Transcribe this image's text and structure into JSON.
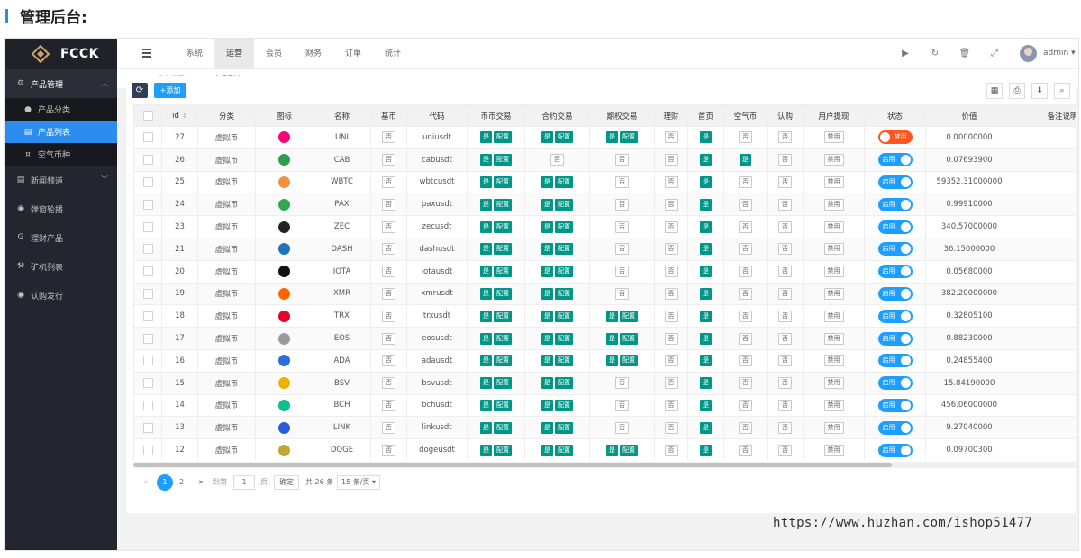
{
  "page_heading": "管理后台:",
  "app": {
    "logo_text": "FCCK",
    "sidebar": {
      "groups": [
        {
          "label": "产品管理",
          "icon": "gear-icon",
          "expanded": true,
          "children": [
            {
              "label": "产品分类",
              "icon": "dot-icon"
            },
            {
              "label": "产品列表",
              "icon": "list-icon",
              "active": true
            },
            {
              "label": "空气币种",
              "icon": "coin-icon"
            }
          ]
        },
        {
          "label": "新闻频道",
          "icon": "news-icon"
        },
        {
          "label": "弹窗轮播",
          "icon": "slides-icon"
        },
        {
          "label": "理财产品",
          "icon": "finance-icon"
        },
        {
          "label": "矿机列表",
          "icon": "miner-icon"
        },
        {
          "label": "认购发行",
          "icon": "subscribe-icon"
        }
      ]
    },
    "header": {
      "menu": [
        "系统",
        "运营",
        "会员",
        "财务",
        "订单",
        "统计"
      ],
      "active_menu": "运营",
      "user": "admin"
    },
    "tabs": [
      {
        "label": "后台首页",
        "active": false
      },
      {
        "label": "产品列表",
        "active": true,
        "close": "×"
      }
    ]
  },
  "toolbar": {
    "add_label": "+添加",
    "refresh_icon": "⟳"
  },
  "table": {
    "headers": [
      "",
      "id",
      "分类",
      "图标",
      "名称",
      "基币",
      "代码",
      "币币交易",
      "合约交易",
      "期权交易",
      "理财",
      "首页",
      "空气币",
      "认购",
      "用户提现",
      "状态",
      "价值",
      "备注说明"
    ],
    "labels": {
      "yes": "是",
      "no": "否",
      "config": "配置",
      "disable": "禁用",
      "enable": "启用",
      "off": "禁用"
    },
    "rows": [
      {
        "id": "27",
        "category": "虚拟币",
        "name": "UNI",
        "code": "uniusdt",
        "coin_color": "#ff007a",
        "spot": true,
        "contract": true,
        "options": true,
        "home": true,
        "airdrop": false,
        "status": "off",
        "value": "0.00000000"
      },
      {
        "id": "26",
        "category": "虚拟币",
        "name": "CAB",
        "code": "cabusdt",
        "coin_color": "#2e9e4f",
        "spot": true,
        "contract": false,
        "options": false,
        "home": true,
        "airdrop": true,
        "status": "on",
        "value": "0.07693900"
      },
      {
        "id": "25",
        "category": "虚拟币",
        "name": "WBTC",
        "code": "wbtcusdt",
        "coin_color": "#f09242",
        "spot": true,
        "contract": true,
        "options": false,
        "home": true,
        "airdrop": false,
        "status": "on",
        "value": "59352.31000000"
      },
      {
        "id": "24",
        "category": "虚拟币",
        "name": "PAX",
        "code": "paxusdt",
        "coin_color": "#2fa84f",
        "spot": true,
        "contract": true,
        "options": false,
        "home": true,
        "airdrop": false,
        "status": "on",
        "value": "0.99910000"
      },
      {
        "id": "23",
        "category": "虚拟币",
        "name": "ZEC",
        "code": "zecusdt",
        "coin_color": "#222222",
        "spot": true,
        "contract": true,
        "options": false,
        "home": true,
        "airdrop": false,
        "status": "on",
        "value": "340.57000000"
      },
      {
        "id": "21",
        "category": "虚拟币",
        "name": "DASH",
        "code": "dashusdt",
        "coin_color": "#1c75bc",
        "spot": true,
        "contract": true,
        "options": false,
        "home": true,
        "airdrop": false,
        "status": "on",
        "value": "36.15000000"
      },
      {
        "id": "20",
        "category": "虚拟币",
        "name": "IOTA",
        "code": "iotausdt",
        "coin_color": "#111111",
        "spot": true,
        "contract": true,
        "options": false,
        "home": true,
        "airdrop": false,
        "status": "on",
        "value": "0.05680000"
      },
      {
        "id": "19",
        "category": "虚拟币",
        "name": "XMR",
        "code": "xmrusdt",
        "coin_color": "#ff6600",
        "spot": true,
        "contract": true,
        "options": false,
        "home": true,
        "airdrop": false,
        "status": "on",
        "value": "382.20000000"
      },
      {
        "id": "18",
        "category": "虚拟币",
        "name": "TRX",
        "code": "trxusdt",
        "coin_color": "#eb0029",
        "spot": true,
        "contract": true,
        "options": true,
        "home": true,
        "airdrop": false,
        "status": "on",
        "value": "0.32805100"
      },
      {
        "id": "17",
        "category": "虚拟币",
        "name": "EOS",
        "code": "eosusdt",
        "coin_color": "#9a9a9a",
        "spot": true,
        "contract": true,
        "options": true,
        "home": true,
        "airdrop": false,
        "status": "on",
        "value": "0.88230000"
      },
      {
        "id": "16",
        "category": "虚拟币",
        "name": "ADA",
        "code": "adausdt",
        "coin_color": "#2a6fdb",
        "spot": true,
        "contract": true,
        "options": true,
        "home": true,
        "airdrop": false,
        "status": "on",
        "value": "0.24855400"
      },
      {
        "id": "15",
        "category": "虚拟币",
        "name": "BSV",
        "code": "bsvusdt",
        "coin_color": "#eab300",
        "spot": true,
        "contract": true,
        "options": false,
        "home": true,
        "airdrop": false,
        "status": "on",
        "value": "15.84190000"
      },
      {
        "id": "14",
        "category": "虚拟币",
        "name": "BCH",
        "code": "bchusdt",
        "coin_color": "#0ac18e",
        "spot": true,
        "contract": true,
        "options": false,
        "home": true,
        "airdrop": false,
        "status": "on",
        "value": "456.06000000"
      },
      {
        "id": "13",
        "category": "虚拟币",
        "name": "LINK",
        "code": "linkusdt",
        "coin_color": "#2a5ada",
        "spot": true,
        "contract": true,
        "options": false,
        "home": true,
        "airdrop": false,
        "status": "on",
        "value": "9.27040000"
      },
      {
        "id": "12",
        "category": "虚拟币",
        "name": "DOGE",
        "code": "dogeusdt",
        "coin_color": "#c2a633",
        "spot": true,
        "contract": true,
        "options": true,
        "home": true,
        "airdrop": false,
        "status": "on",
        "value": "0.09700300"
      }
    ]
  },
  "pagination": {
    "prev": "<",
    "current": "1",
    "next_page": "2",
    "next": ">",
    "goto_label": "到第",
    "page_input": "1",
    "page_suffix": "页",
    "confirm": "确定",
    "total": "共 26 条",
    "page_size": "15 条/页"
  },
  "watermark": "https://www.huzhan.com/ishop51477"
}
